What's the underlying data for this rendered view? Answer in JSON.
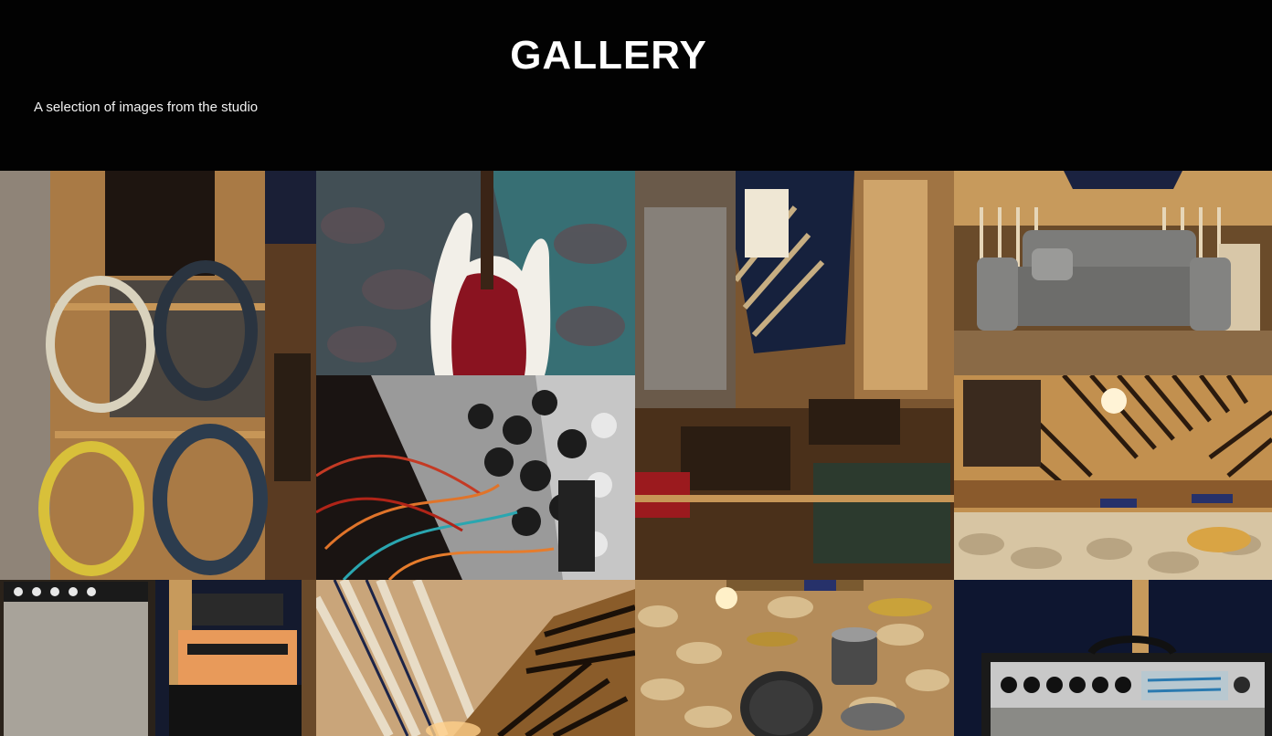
{
  "header": {
    "title": "GALLERY",
    "subtitle": "A selection of images from the studio"
  },
  "gallery": {
    "images": [
      {
        "subject": "cables-hanging-on-wall-icon"
      },
      {
        "subject": "bass-guitar-on-stone-wall-icon"
      },
      {
        "subject": "bookshelves-and-skylight-icon"
      },
      {
        "subject": "grey-sofa-loft-icon"
      },
      {
        "subject": "modular-synth-patch-cables-icon"
      },
      {
        "subject": "slatted-ceiling-room-icon"
      },
      {
        "subject": "guitar-amps-stack-icon"
      },
      {
        "subject": "slatted-wooden-ceiling-icon"
      },
      {
        "subject": "drum-kit-stone-room-icon"
      },
      {
        "subject": "princeton-reverb-amp-icon"
      }
    ]
  },
  "colors": {
    "background": "#020202",
    "text": "#ffffff",
    "wood": "#b98646",
    "navy": "#1a2240",
    "stone": "#7a6a58"
  }
}
